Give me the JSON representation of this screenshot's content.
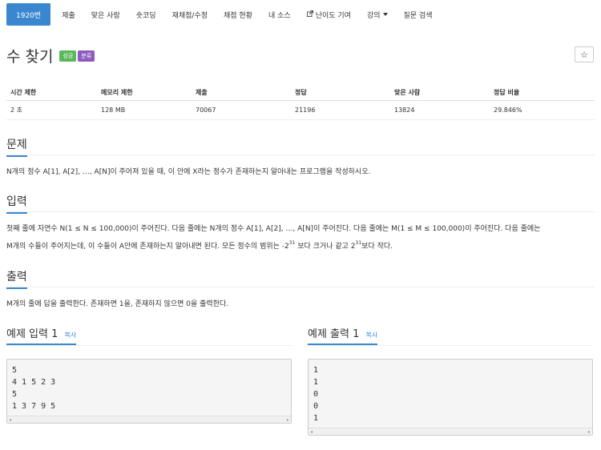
{
  "nav": {
    "items": [
      {
        "label": "1920번",
        "active": true
      },
      {
        "label": "제출"
      },
      {
        "label": "맞은 사람"
      },
      {
        "label": "숏코딩"
      },
      {
        "label": "재채점/수정"
      },
      {
        "label": "채점 현황"
      },
      {
        "label": "내 소스"
      },
      {
        "label": "난이도 기여",
        "icon": "external-link-icon"
      },
      {
        "label": "강의",
        "dropdown": true
      },
      {
        "label": "질문 검색"
      }
    ]
  },
  "problem": {
    "title": "수 찾기",
    "badges": [
      "성공",
      "분류"
    ],
    "star": "☆"
  },
  "stats": {
    "headers": [
      "시간 제한",
      "메모리 제한",
      "제출",
      "정답",
      "맞은 사람",
      "정답 비율"
    ],
    "values": [
      "2 초",
      "128 MB",
      "70067",
      "21196",
      "13824",
      "29.846%"
    ]
  },
  "sections": {
    "problem_title": "문제",
    "problem_text": "N개의 정수 A[1], A[2], …, A[N]이 주어져 있을 때, 이 안에 X라는 정수가 존재하는지 알아내는 프로그램을 작성하시오.",
    "input_title": "입력",
    "input_text_1": "첫째 줄에 자연수 N(1 ≤ N ≤ 100,000)이 주어진다. 다음 줄에는 N개의 정수 A[1], A[2], …, A[N]이 주어진다. 다음 줄에는 M(1 ≤ M ≤ 100,000)이 주어진다. 다음 줄에는",
    "input_text_2a": "M개의 수들이 주어지는데, 이 수들이 A안에 존재하는지 알아내면 된다. 모든 정수의 범위는 -2",
    "input_sup_1": "31",
    "input_text_2b": " 보다 크거나 같고 2",
    "input_sup_2": "31",
    "input_text_2c": "보다 작다.",
    "output_title": "출력",
    "output_text": "M개의 줄에 답을 출력한다. 존재하면 1을, 존재하지 않으면 0을 출력한다."
  },
  "samples": {
    "input_title": "예제 입력 1",
    "output_title": "예제 출력 1",
    "copy_label": "복사",
    "input_lines": [
      "5",
      "4 1 5 2 3",
      "5",
      "1 3 7 9 5"
    ],
    "output_lines": [
      "1",
      "1",
      "0",
      "0",
      "1"
    ],
    "scroll_left": "◂",
    "scroll_right": "▸"
  }
}
